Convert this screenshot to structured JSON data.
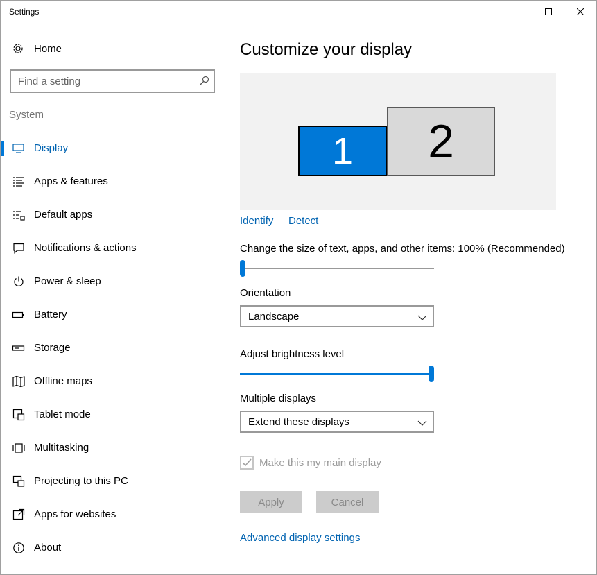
{
  "window": {
    "title": "Settings"
  },
  "sidebar": {
    "home_label": "Home",
    "search_placeholder": "Find a setting",
    "section_label": "System",
    "items": [
      {
        "label": "Display",
        "icon": "monitor-icon",
        "active": true
      },
      {
        "label": "Apps & features",
        "icon": "list-icon"
      },
      {
        "label": "Default apps",
        "icon": "default-apps-icon"
      },
      {
        "label": "Notifications & actions",
        "icon": "notification-icon"
      },
      {
        "label": "Power & sleep",
        "icon": "power-icon"
      },
      {
        "label": "Battery",
        "icon": "battery-icon"
      },
      {
        "label": "Storage",
        "icon": "storage-icon"
      },
      {
        "label": "Offline maps",
        "icon": "map-icon"
      },
      {
        "label": "Tablet mode",
        "icon": "tablet-icon"
      },
      {
        "label": "Multitasking",
        "icon": "multitasking-icon"
      },
      {
        "label": "Projecting to this PC",
        "icon": "projecting-icon"
      },
      {
        "label": "Apps for websites",
        "icon": "apps-websites-icon"
      },
      {
        "label": "About",
        "icon": "info-icon"
      }
    ]
  },
  "main": {
    "title": "Customize your display",
    "monitors": {
      "one": "1",
      "two": "2"
    },
    "identify_label": "Identify",
    "detect_label": "Detect",
    "scale_label": "Change the size of text, apps, and other items: 100% (Recommended)",
    "scale_value_fraction": 0.0,
    "orientation_label": "Orientation",
    "orientation_value": "Landscape",
    "brightness_label": "Adjust brightness level",
    "brightness_value_fraction": 1.0,
    "multiple_label": "Multiple displays",
    "multiple_value": "Extend these displays",
    "main_display_label": "Make this my main display",
    "main_display_checked": true,
    "apply_label": "Apply",
    "cancel_label": "Cancel",
    "advanced_label": "Advanced display settings"
  },
  "colors": {
    "accent": "#0078d7",
    "link": "#0063b1"
  }
}
